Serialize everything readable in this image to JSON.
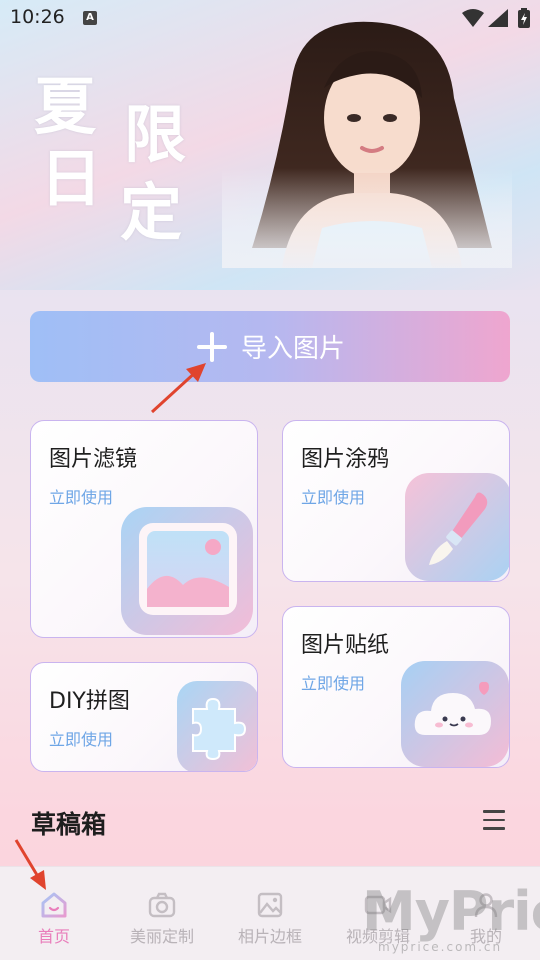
{
  "status_bar": {
    "time": "10:26",
    "notification_letter": "A"
  },
  "banner": {
    "calligraphy": [
      "夏",
      "日",
      "限",
      "定"
    ]
  },
  "import_button": {
    "label": "导入图片"
  },
  "cards": [
    {
      "title": "图片滤镜",
      "subtitle": "立即使用",
      "icon": "image-frame-icon"
    },
    {
      "title": "图片涂鸦",
      "subtitle": "立即使用",
      "icon": "paintbrush-icon"
    },
    {
      "title": "DIY拼图",
      "subtitle": "立即使用",
      "icon": "puzzle-icon"
    },
    {
      "title": "图片贴纸",
      "subtitle": "立即使用",
      "icon": "cloud-sticker-icon"
    }
  ],
  "drafts": {
    "title": "草稿箱"
  },
  "bottom_nav": {
    "items": [
      {
        "label": "首页",
        "icon": "home-icon",
        "active": true
      },
      {
        "label": "美丽定制",
        "icon": "camera-icon",
        "active": false
      },
      {
        "label": "相片边框",
        "icon": "picture-icon",
        "active": false
      },
      {
        "label": "视频剪辑",
        "icon": "video-icon",
        "active": false
      },
      {
        "label": "我的",
        "icon": "profile-icon",
        "active": false
      }
    ]
  },
  "watermark": {
    "text": "MyPrice",
    "sub": "myprice.com.cn"
  },
  "colors": {
    "accent_pink": "#e97dbb",
    "sub_blue": "#6fa6e6",
    "card_border": "#c9b4ef",
    "arrow_red": "#e0442e"
  }
}
